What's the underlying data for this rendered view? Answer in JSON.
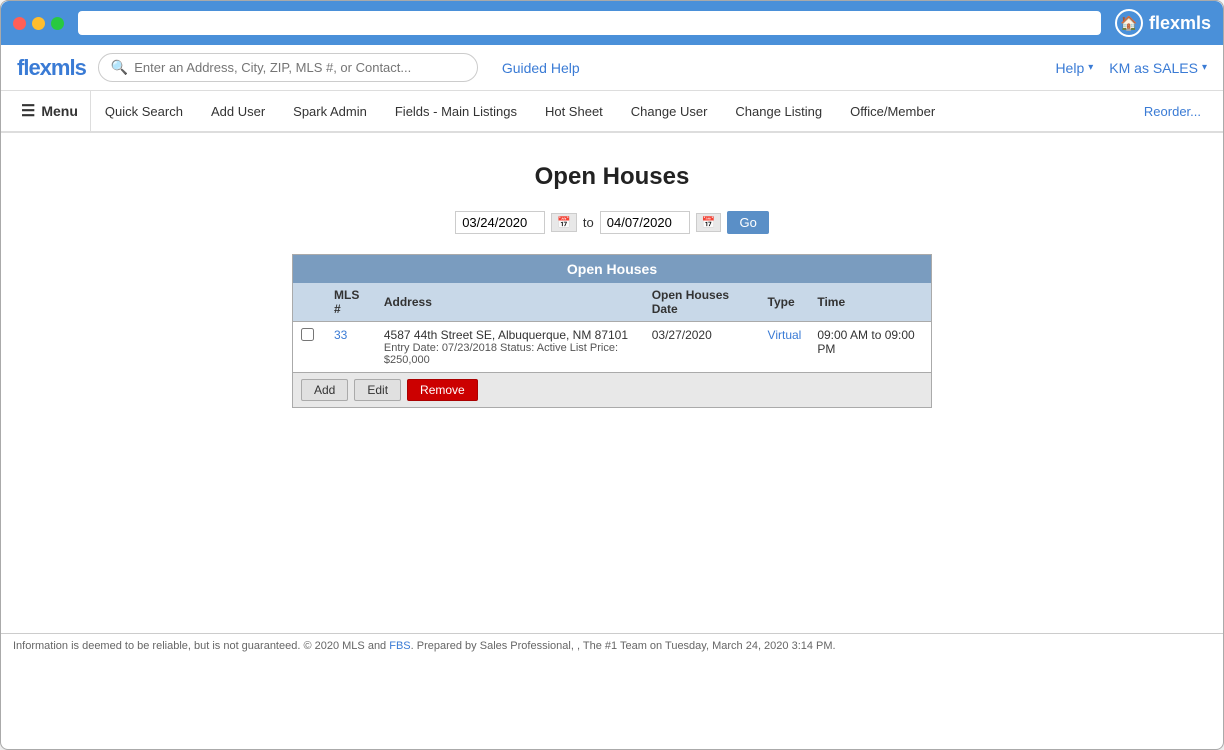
{
  "window": {
    "chrome_color": "#4a90d9",
    "address_bar_placeholder": ""
  },
  "brand": {
    "logo_text": "flexmls",
    "logo_icon": "🏠"
  },
  "topnav": {
    "search_placeholder": "Enter an Address, City, ZIP, MLS #, or Contact...",
    "guided_help": "Guided Help",
    "help_label": "Help",
    "user_label": "KM as SALES"
  },
  "menubar": {
    "toggle_label": "Menu",
    "items": [
      {
        "label": "Quick Search",
        "id": "quick-search"
      },
      {
        "label": "Add User",
        "id": "add-user"
      },
      {
        "label": "Spark Admin",
        "id": "spark-admin"
      },
      {
        "label": "Fields - Main Listings",
        "id": "fields-main"
      },
      {
        "label": "Hot Sheet",
        "id": "hot-sheet"
      },
      {
        "label": "Change User",
        "id": "change-user"
      },
      {
        "label": "Change Listing",
        "id": "change-listing"
      },
      {
        "label": "Office/Member",
        "id": "office-member"
      }
    ],
    "reorder_label": "Reorder..."
  },
  "page": {
    "title": "Open Houses",
    "date_from": "03/24/2020",
    "date_to": "04/07/2020",
    "go_label": "Go"
  },
  "table": {
    "title": "Open Houses",
    "columns": [
      {
        "key": "mls",
        "label": "MLS #"
      },
      {
        "key": "address",
        "label": "Address"
      },
      {
        "key": "date",
        "label": "Open Houses Date"
      },
      {
        "key": "type",
        "label": "Type"
      },
      {
        "key": "time",
        "label": "Time"
      }
    ],
    "rows": [
      {
        "mls": "33",
        "address_line1": "4587 44th Street SE, Albuquerque, NM 87101",
        "address_meta": "Entry Date: 07/23/2018  Status: Active   List Price: $250,000",
        "date": "03/27/2020",
        "type": "Virtual",
        "time": "09:00 AM to 09:00 PM"
      }
    ],
    "add_label": "Add",
    "edit_label": "Edit",
    "remove_label": "Remove"
  },
  "footer": {
    "text_before": "Information is deemed to be reliable, but is not guaranteed. © 2020 MLS and ",
    "fbs_link": "FBS",
    "text_after": ". Prepared by Sales Professional, , The #1 Team on Tuesday, March 24, 2020 3:14 PM."
  }
}
